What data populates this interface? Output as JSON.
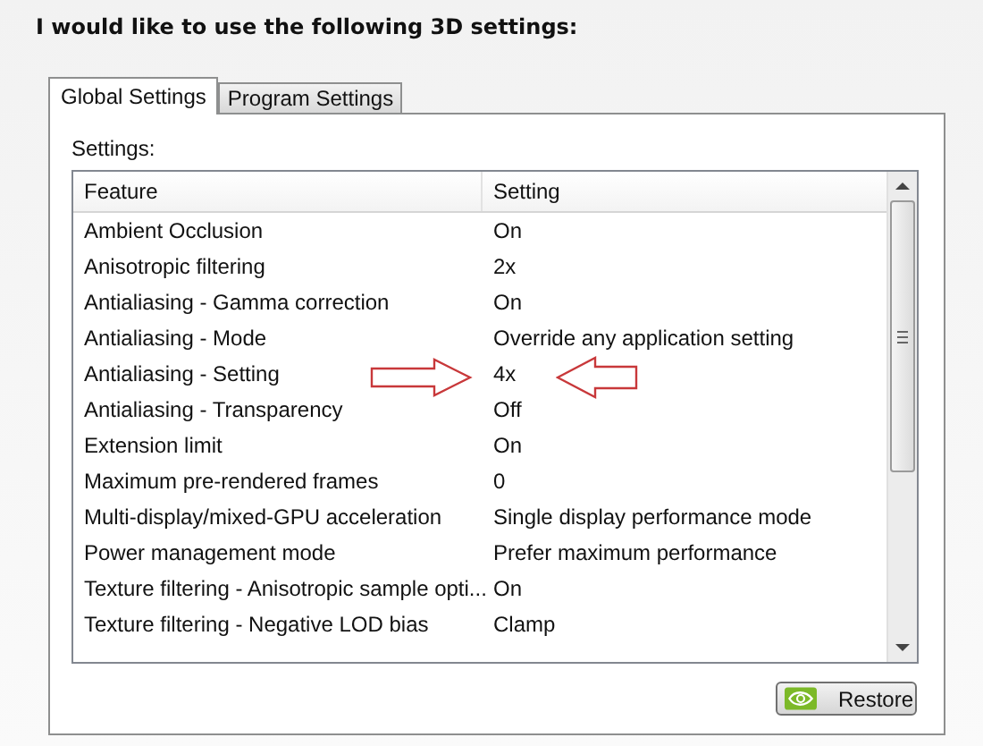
{
  "heading": "I would like to use the following 3D settings:",
  "tabs": [
    {
      "label": "Global Settings",
      "selected": true
    },
    {
      "label": "Program Settings",
      "selected": false
    }
  ],
  "settings_label": "Settings:",
  "table": {
    "columns": [
      "Feature",
      "Setting"
    ],
    "rows": [
      {
        "feature": "Ambient Occlusion",
        "setting": "On"
      },
      {
        "feature": "Anisotropic filtering",
        "setting": "2x"
      },
      {
        "feature": "Antialiasing - Gamma correction",
        "setting": "On"
      },
      {
        "feature": "Antialiasing - Mode",
        "setting": "Override any application setting"
      },
      {
        "feature": "Antialiasing - Setting",
        "setting": "4x"
      },
      {
        "feature": "Antialiasing - Transparency",
        "setting": "Off"
      },
      {
        "feature": "Extension limit",
        "setting": "On"
      },
      {
        "feature": "Maximum pre-rendered frames",
        "setting": "0"
      },
      {
        "feature": "Multi-display/mixed-GPU acceleration",
        "setting": "Single display performance mode"
      },
      {
        "feature": "Power management mode",
        "setting": "Prefer maximum performance"
      },
      {
        "feature": "Texture filtering - Anisotropic sample opti...",
        "setting": "On"
      },
      {
        "feature": "Texture filtering - Negative LOD bias",
        "setting": "Clamp"
      }
    ]
  },
  "restore_button": "Restore"
}
